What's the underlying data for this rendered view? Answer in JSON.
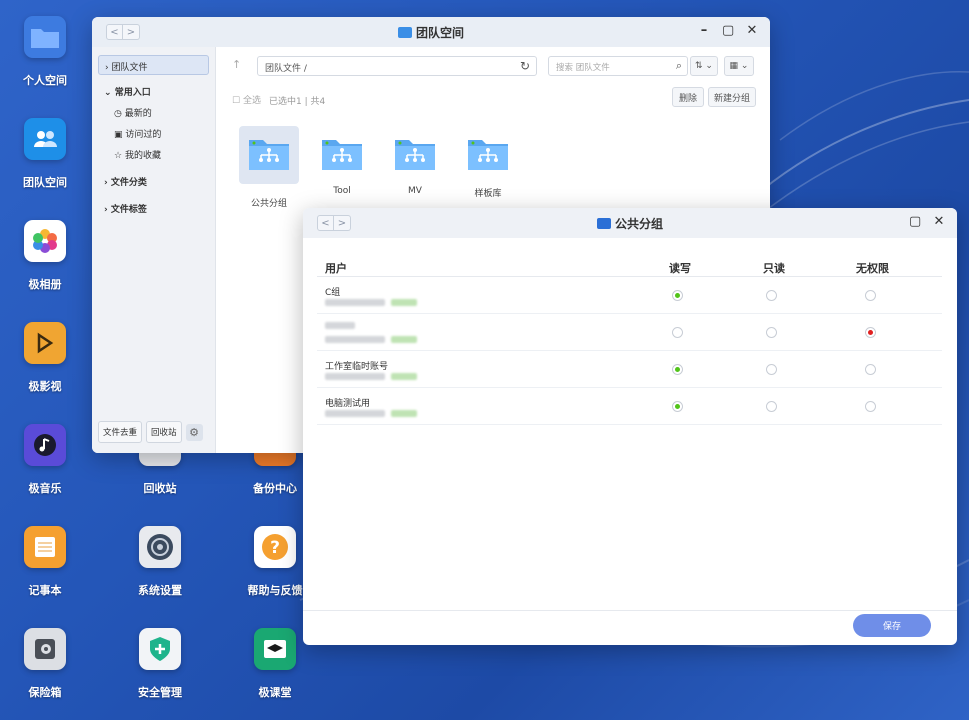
{
  "desktop": {
    "icons": [
      {
        "label": "个人空间",
        "icon": "folder-icon"
      },
      {
        "label": "团队空间",
        "icon": "team-folder-icon"
      },
      {
        "label": "极相册",
        "icon": "photos-icon"
      },
      {
        "label": "极影视",
        "icon": "video-icon"
      },
      {
        "label": "极音乐",
        "icon": "music-icon"
      },
      {
        "label": "回收站",
        "icon": "recycle-bin-icon"
      },
      {
        "label": "备份中心",
        "icon": "backup-icon"
      },
      {
        "label": "记事本",
        "icon": "notepad-icon"
      },
      {
        "label": "系统设置",
        "icon": "settings-icon"
      },
      {
        "label": "帮助与反馈",
        "icon": "help-icon"
      },
      {
        "label": "保险箱",
        "icon": "safe-icon"
      },
      {
        "label": "安全管理",
        "icon": "security-icon"
      },
      {
        "label": "极课堂",
        "icon": "classroom-icon"
      }
    ]
  },
  "team_window": {
    "title": "团队空间",
    "nav_back": "<",
    "nav_forward": ">",
    "sidebar": {
      "selected": "团队文件",
      "common_header": "常用入口",
      "common_items": [
        "最新的",
        "访问过的",
        "我的收藏"
      ],
      "file_category": "文件分类",
      "file_tags": "文件标签",
      "dedupe_button": "文件去重",
      "recycle_button": "回收站"
    },
    "path": "团队文件 /",
    "search_placeholder": "搜索 团队文件",
    "select_all": "全选",
    "selection_info": "已选中1 | 共4",
    "delete_button": "删除",
    "new_group_button": "新建分组",
    "folders": [
      "公共分组",
      "Tool",
      "MV",
      "样板库"
    ]
  },
  "perm_window": {
    "title": "公共分组",
    "headers": {
      "user": "用户",
      "read_write": "读写",
      "read_only": "只读",
      "no_access": "无权限"
    },
    "rows": [
      {
        "name": "C组",
        "permission": "read_write"
      },
      {
        "name": "",
        "permission": "no_access"
      },
      {
        "name": "工作室临时账号",
        "permission": "read_write"
      },
      {
        "name": "电脑测试用",
        "permission": "read_write"
      }
    ],
    "save_button": "保存"
  },
  "colors": {
    "desktop_bg": "#2456b8",
    "accent": "#6f8ee8",
    "radio_green": "#52c41a",
    "radio_red": "#e02020"
  }
}
